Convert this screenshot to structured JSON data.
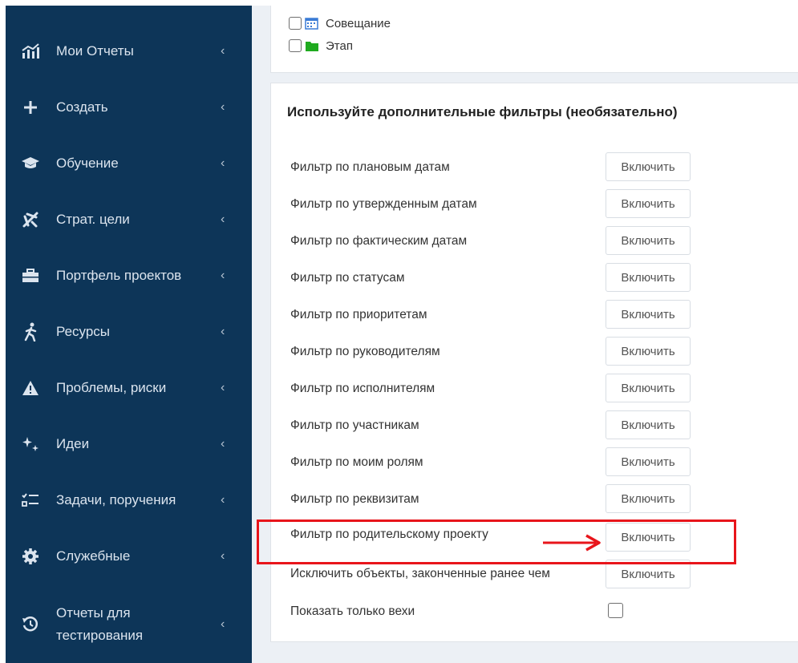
{
  "colors": {
    "sidebar_bg": "#0d3558",
    "sidebar_text": "#dbe4ee",
    "highlight": "#e8151b",
    "calendar_icon": "#3a7bd5",
    "folder_icon": "#1faa1f"
  },
  "sidebar": {
    "items": [
      {
        "label": "Мои Отчеты",
        "icon": "chart-icon"
      },
      {
        "label": "Создать",
        "icon": "plus-icon"
      },
      {
        "label": "Обучение",
        "icon": "graduation-cap-icon"
      },
      {
        "label": "Страт. цели",
        "icon": "plane-icon"
      },
      {
        "label": "Портфель проектов",
        "icon": "briefcase-icon"
      },
      {
        "label": "Ресурсы",
        "icon": "running-person-icon"
      },
      {
        "label": "Проблемы, риски",
        "icon": "warning-icon"
      },
      {
        "label": "Идеи",
        "icon": "sparkle-icon"
      },
      {
        "label": "Задачи, поручения",
        "icon": "task-list-icon"
      },
      {
        "label": "Служебные",
        "icon": "gear-icon"
      },
      {
        "label": "Отчеты для тестирования",
        "icon": "history-icon"
      }
    ],
    "chevron": "‹"
  },
  "types": [
    {
      "label": "Совещание",
      "icon": "calendar-icon"
    },
    {
      "label": "Этап",
      "icon": "folder-icon"
    }
  ],
  "filters": {
    "title": "Используйте дополнительные фильтры (необязательно)",
    "button_label": "Включить",
    "rows": [
      {
        "label": "Фильтр по плановым датам"
      },
      {
        "label": "Фильтр по утвержденным датам"
      },
      {
        "label": "Фильтр по фактическим датам"
      },
      {
        "label": "Фильтр по статусам"
      },
      {
        "label": "Фильтр по приоритетам"
      },
      {
        "label": "Фильтр по руководителям"
      },
      {
        "label": "Фильтр по исполнителям"
      },
      {
        "label": "Фильтр по участникам"
      },
      {
        "label": "Фильтр по моим ролям"
      },
      {
        "label": "Фильтр по реквизитам"
      },
      {
        "label": "Фильтр по родительскому проекту"
      },
      {
        "label": "Исключить объекты, законченные ранее чем"
      }
    ],
    "milestones_label": "Показать только вехи"
  }
}
